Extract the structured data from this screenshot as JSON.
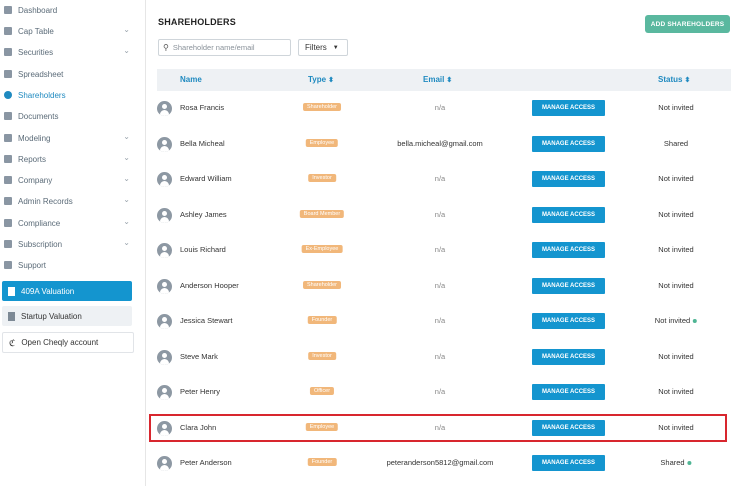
{
  "sidebar": {
    "items": [
      {
        "label": "Dashboard",
        "chevron": false,
        "active": false
      },
      {
        "label": "Cap Table",
        "chevron": true,
        "active": false
      },
      {
        "label": "Securities",
        "chevron": true,
        "active": false
      },
      {
        "label": "Spreadsheet",
        "chevron": false,
        "active": false
      },
      {
        "label": "Shareholders",
        "chevron": false,
        "active": true
      },
      {
        "label": "Documents",
        "chevron": false,
        "active": false
      },
      {
        "label": "Modeling",
        "chevron": true,
        "active": false
      },
      {
        "label": "Reports",
        "chevron": true,
        "active": false
      },
      {
        "label": "Company",
        "chevron": true,
        "active": false
      },
      {
        "label": "Admin Records",
        "chevron": true,
        "active": false
      },
      {
        "label": "Compliance",
        "chevron": true,
        "active": false
      },
      {
        "label": "Subscription",
        "chevron": true,
        "active": false
      },
      {
        "label": "Support",
        "chevron": false,
        "active": false
      }
    ],
    "valuation_409a": "409A Valuation",
    "startup_valuation": "Startup Valuation",
    "open_cheqly": "Open Cheqly account"
  },
  "main": {
    "title": "SHAREHOLDERS",
    "add_button": "ADD SHAREHOLDERS",
    "search_placeholder": "Shareholder name/email",
    "filters_label": "Filters",
    "columns": {
      "name": "Name",
      "type": "Type",
      "email": "Email",
      "status": "Status"
    },
    "manage_label": "MANAGE ACCESS",
    "rows": [
      {
        "name": "Rosa Francis",
        "type": "Shareholder",
        "email": "n/a",
        "status": "Not invited",
        "dot": false
      },
      {
        "name": "Bella Micheal",
        "type": "Employee",
        "email": "bella.micheal@gmail.com",
        "status": "Shared",
        "dot": false
      },
      {
        "name": "Edward William",
        "type": "Investor",
        "email": "n/a",
        "status": "Not invited",
        "dot": false
      },
      {
        "name": "Ashley James",
        "type": "Board Member",
        "email": "n/a",
        "status": "Not invited",
        "dot": false
      },
      {
        "name": "Louis Richard",
        "type": "Ex-Employee",
        "email": "n/a",
        "status": "Not invited",
        "dot": false
      },
      {
        "name": "Anderson Hooper",
        "type": "Shareholder",
        "email": "n/a",
        "status": "Not invited",
        "dot": false
      },
      {
        "name": "Jessica Stewart",
        "type": "Founder",
        "email": "n/a",
        "status": "Not invited",
        "dot": true
      },
      {
        "name": "Steve Mark",
        "type": "Investor",
        "email": "n/a",
        "status": "Not invited",
        "dot": false
      },
      {
        "name": "Peter Henry",
        "type": "Officer",
        "email": "n/a",
        "status": "Not invited",
        "dot": false
      },
      {
        "name": "Clara John",
        "type": "Employee",
        "email": "n/a",
        "status": "Not invited",
        "dot": false,
        "highlighted": true
      },
      {
        "name": "Peter Anderson",
        "type": "Founder",
        "email": "peteranderson5812@gmail.com",
        "status": "Shared",
        "dot": true
      }
    ]
  },
  "colors": {
    "accent": "#1495cf",
    "add_button": "#5ab89f",
    "badge": "#f1b77a",
    "highlight": "#d8262e"
  }
}
